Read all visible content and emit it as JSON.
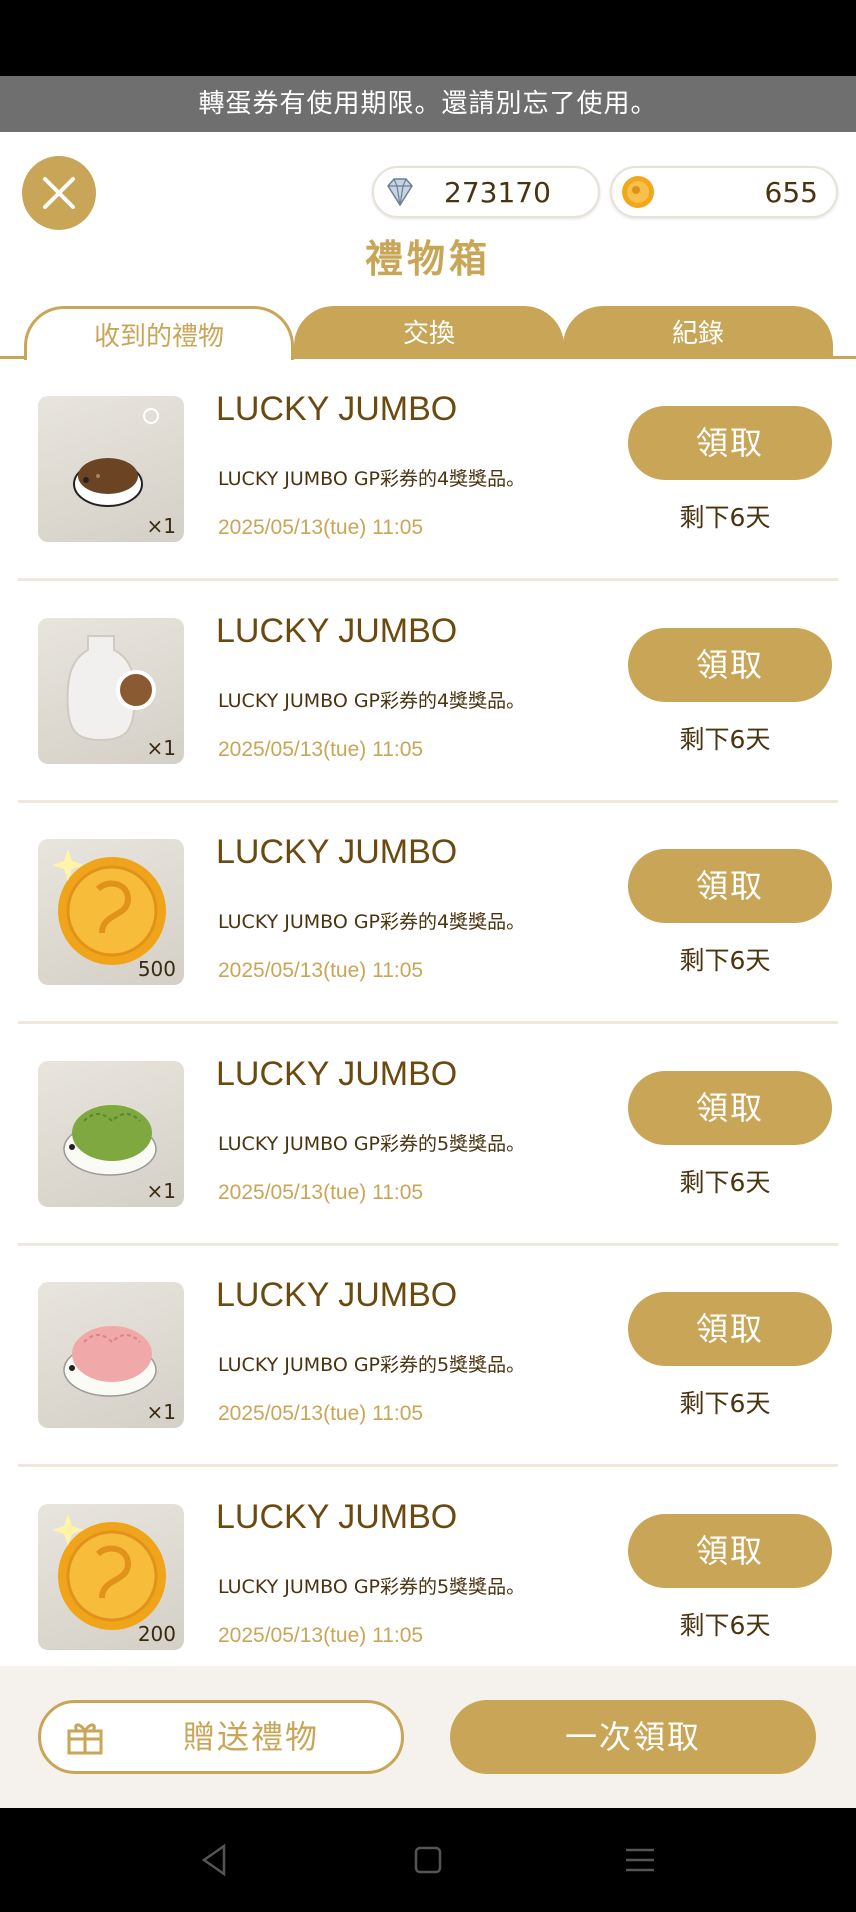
{
  "notice": "轉蛋券有使用期限。還請別忘了使用。",
  "currency": {
    "gems": "273170",
    "coins": "655"
  },
  "title": "禮物箱",
  "tabs": [
    "收到的禮物",
    "交換",
    "紀錄"
  ],
  "items": [
    {
      "name": "LUCKY JUMBO",
      "desc": "LUCKY JUMBO GP彩券的4獎獎品。",
      "date": "2025/05/13(tue) 11:05",
      "qty": "×1",
      "icon": "brown-hamster-icon",
      "claim": "領取",
      "remain": "剩下6天"
    },
    {
      "name": "LUCKY JUMBO",
      "desc": "LUCKY JUMBO GP彩券的4獎獎品。",
      "date": "2025/05/13(tue) 11:05",
      "qty": "×1",
      "icon": "hamster-plush-icon",
      "claim": "領取",
      "remain": "剩下6天"
    },
    {
      "name": "LUCKY JUMBO",
      "desc": "LUCKY JUMBO GP彩券的4獎獎品。",
      "date": "2025/05/13(tue) 11:05",
      "qty": "500",
      "icon": "gold-coin-icon",
      "claim": "領取",
      "remain": "剩下6天"
    },
    {
      "name": "LUCKY JUMBO",
      "desc": "LUCKY JUMBO GP彩券的5獎獎品。",
      "date": "2025/05/13(tue) 11:05",
      "qty": "×1",
      "icon": "green-hamster-icon",
      "claim": "領取",
      "remain": "剩下6天"
    },
    {
      "name": "LUCKY JUMBO",
      "desc": "LUCKY JUMBO GP彩券的5獎獎品。",
      "date": "2025/05/13(tue) 11:05",
      "qty": "×1",
      "icon": "pink-hamster-icon",
      "claim": "領取",
      "remain": "剩下6天"
    },
    {
      "name": "LUCKY JUMBO",
      "desc": "LUCKY JUMBO GP彩券的5獎獎品。",
      "date": "2025/05/13(tue) 11:05",
      "qty": "200",
      "icon": "gold-coin-icon",
      "claim": "領取",
      "remain": "剩下6天"
    }
  ],
  "bottom": {
    "send": "贈送禮物",
    "claim_all": "一次領取"
  },
  "colors": {
    "accent": "#c9a657",
    "text": "#6b4a10"
  }
}
